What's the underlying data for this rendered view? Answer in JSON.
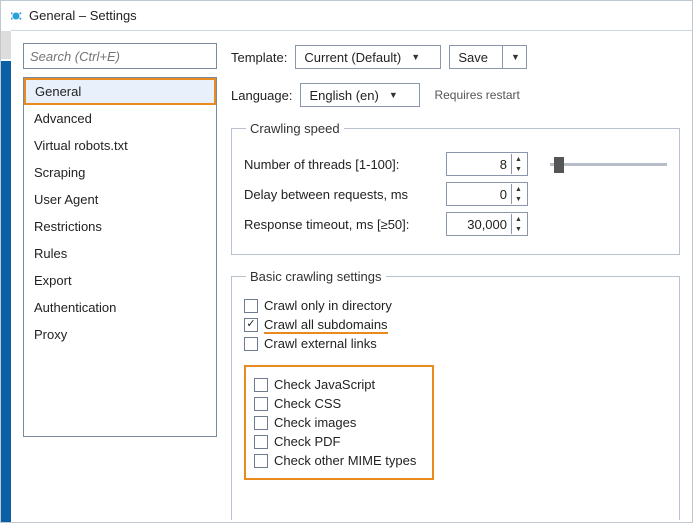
{
  "window": {
    "title": "General – Settings"
  },
  "search": {
    "placeholder": "Search (Ctrl+E)"
  },
  "sidebar": {
    "items": [
      {
        "label": "General",
        "active": true
      },
      {
        "label": "Advanced"
      },
      {
        "label": "Virtual robots.txt"
      },
      {
        "label": "Scraping"
      },
      {
        "label": "User Agent"
      },
      {
        "label": "Restrictions"
      },
      {
        "label": "Rules"
      },
      {
        "label": "Export"
      },
      {
        "label": "Authentication"
      },
      {
        "label": "Proxy"
      }
    ]
  },
  "header": {
    "template_label": "Template:",
    "template_value": "Current (Default)",
    "save_label": "Save",
    "language_label": "Language:",
    "language_value": "English (en)",
    "requires": "Requires restart"
  },
  "crawling_speed": {
    "legend": "Crawling speed",
    "threads_label": "Number of threads [1-100]:",
    "threads_value": "8",
    "delay_label": "Delay between requests, ms",
    "delay_value": "0",
    "timeout_label": "Response timeout, ms [≥50]:",
    "timeout_value": "30,000"
  },
  "basic": {
    "legend": "Basic crawling settings",
    "crawl_dir": "Crawl only in directory",
    "crawl_sub": "Crawl all subdomains",
    "crawl_ext": "Crawl external links",
    "check_js": "Check JavaScript",
    "check_css": "Check CSS",
    "check_img": "Check images",
    "check_pdf": "Check PDF",
    "check_mime": "Check other MIME types"
  }
}
